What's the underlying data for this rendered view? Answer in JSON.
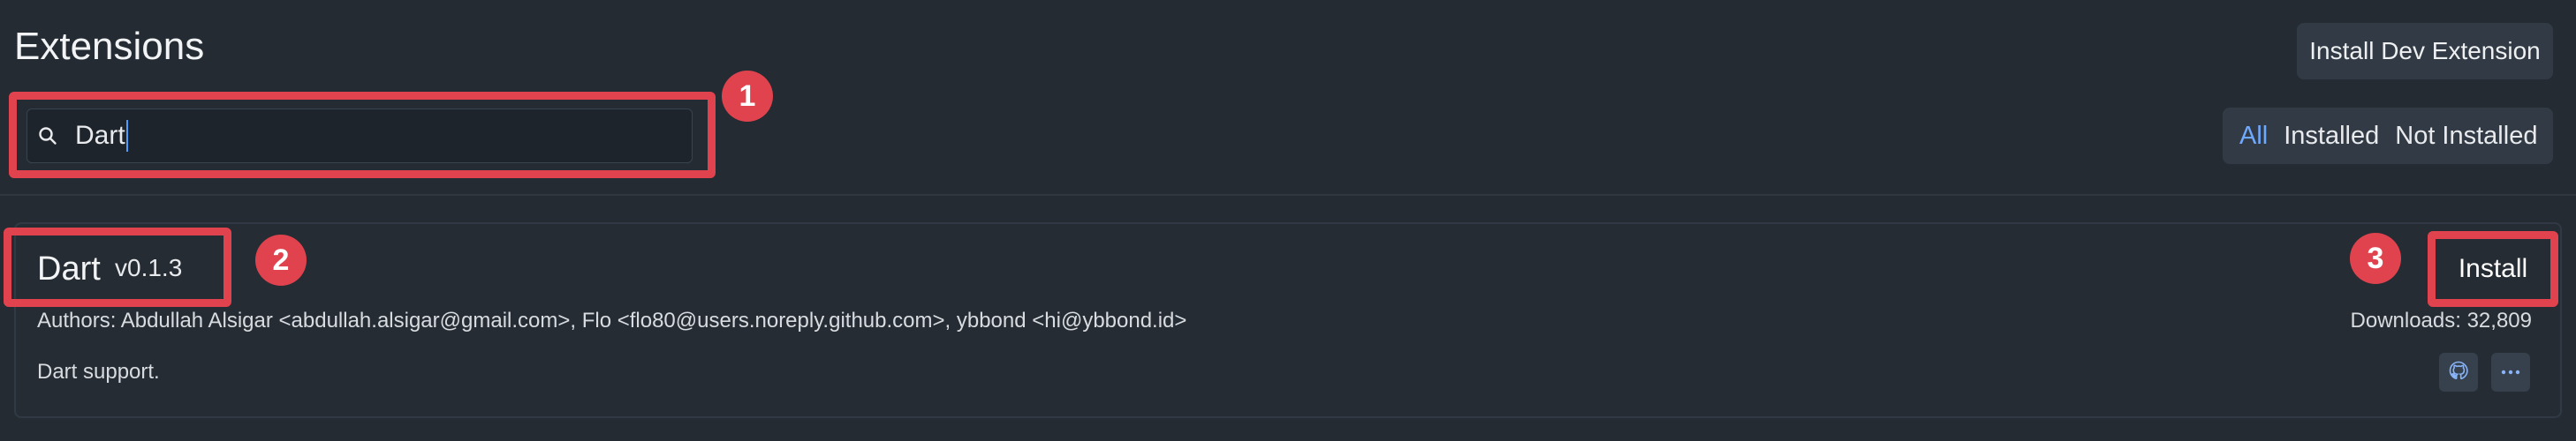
{
  "header": {
    "title": "Extensions",
    "dev_button_label": "Install Dev Extension"
  },
  "search": {
    "value": "Dart",
    "icon": "search-icon"
  },
  "filters": {
    "tabs": [
      {
        "label": "All",
        "active": true
      },
      {
        "label": "Installed",
        "active": false
      },
      {
        "label": "Not Installed",
        "active": false
      }
    ]
  },
  "extension": {
    "name": "Dart",
    "version": "v0.1.3",
    "authors": "Authors: Abdullah Alsigar <abdullah.alsigar@gmail.com>, Flo <flo80@users.noreply.github.com>, ybbond <hi@ybbond.id>",
    "description": "Dart support.",
    "install_label": "Install",
    "downloads": "Downloads: 32,809",
    "icons": [
      "github-icon",
      "more-icon"
    ]
  },
  "annotations": {
    "marker_1": "1",
    "marker_2": "2",
    "marker_3": "3",
    "color": "#e0434d"
  },
  "colors": {
    "background": "#242b33",
    "accent": "#6fa8ff",
    "annotation": "#e0434d"
  }
}
